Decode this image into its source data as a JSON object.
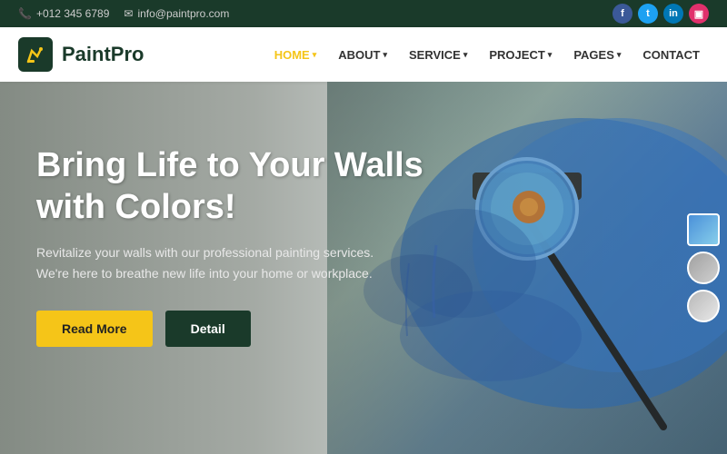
{
  "topbar": {
    "phone": "+012 345 6789",
    "email": "info@paintpro.com",
    "phone_icon": "📞",
    "email_icon": "✉"
  },
  "social": [
    {
      "name": "facebook",
      "label": "f",
      "class": "si-fb"
    },
    {
      "name": "twitter",
      "label": "t",
      "class": "si-tw"
    },
    {
      "name": "linkedin",
      "label": "in",
      "class": "si-li"
    },
    {
      "name": "instagram",
      "label": "ig",
      "class": "si-ig"
    }
  ],
  "logo": {
    "brand_name": "PaintPro",
    "icon_symbol": "🖌"
  },
  "nav": {
    "items": [
      {
        "label": "HOME",
        "active": true,
        "has_dropdown": true
      },
      {
        "label": "ABOUT",
        "active": false,
        "has_dropdown": true
      },
      {
        "label": "SERVICE",
        "active": false,
        "has_dropdown": true
      },
      {
        "label": "PROJECT",
        "active": false,
        "has_dropdown": true
      },
      {
        "label": "PAGES",
        "active": false,
        "has_dropdown": true
      },
      {
        "label": "CONTACT",
        "active": false,
        "has_dropdown": false
      }
    ]
  },
  "hero": {
    "title_line1": "Bring Life to Your Walls",
    "title_line2": "with Colors!",
    "subtitle": "Revitalize your walls with our professional painting services. We're here to breathe new life into your home or workplace.",
    "btn_readmore": "Read More",
    "btn_detail": "Detail"
  },
  "colors": {
    "topbar_bg": "#1a3a2a",
    "logo_bg": "#1a3a2a",
    "accent_yellow": "#f5c518",
    "btn_dark": "#1a3a2a"
  }
}
